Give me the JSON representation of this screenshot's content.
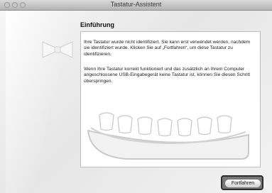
{
  "window": {
    "title": "Tastatur-Assistent"
  },
  "content": {
    "heading": "Einführung",
    "paragraph1": "Ihre Tastatur wurde nicht identifiziert. Sie kann erst verwendet werden, nachdem sie identifiziert wurde. Klicken Sie auf „Fortfahren“, um diese Tastatur zu identifizieren.",
    "paragraph2": "Wenn Ihre Tastatur korrekt funktioniert und das zusätzlich an Ihrem Computer angeschlossene USB-Eingabegerät keine Tastatur ist, können Sie diesen Schritt überspringen."
  },
  "buttons": {
    "continue_label": "Fortfahren"
  }
}
